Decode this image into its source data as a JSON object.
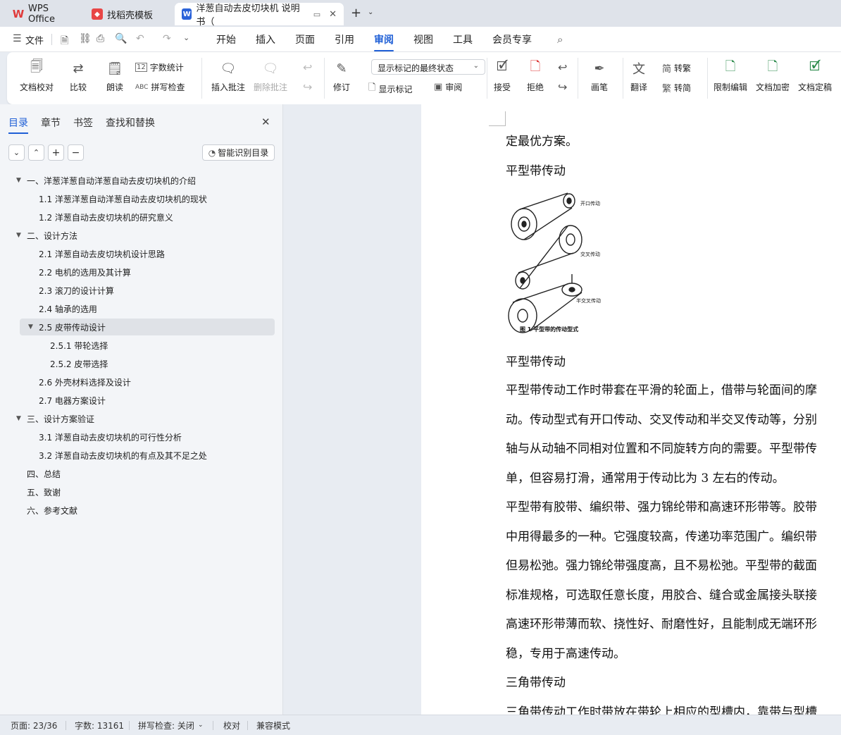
{
  "tabs": [
    {
      "label": "WPS Office",
      "icon": "wps-logo-icon",
      "color": "#e03a3a"
    },
    {
      "label": "找稻壳模板",
      "icon": "docer-logo-icon",
      "color": "#e84646"
    },
    {
      "label": "洋葱自动去皮切块机 说明书（",
      "icon": "word-doc-icon",
      "color": "#2b63d9"
    }
  ],
  "menu": {
    "file": "文件",
    "items": [
      "开始",
      "插入",
      "页面",
      "引用",
      "审阅",
      "视图",
      "工具",
      "会员专享"
    ],
    "active": "审阅"
  },
  "ribbon": {
    "proofread": "文档校对",
    "compare": "比较",
    "read_aloud": "朗读",
    "word_count": "字数统计",
    "spell_check": "拼写检查",
    "insert_comment": "插入批注",
    "delete_comment": "删除批注",
    "track": "修订",
    "show_markup_state": "显示标记的最终状态",
    "show_markup": "显示标记",
    "review": "审阅",
    "accept": "接受",
    "reject": "拒绝",
    "pen": "画笔",
    "translate": "翻译",
    "to_traditional": "转繁",
    "to_simplified": "转简",
    "restrict_edit": "限制编辑",
    "encrypt": "文档加密",
    "finalize": "文档定稿"
  },
  "sidebar": {
    "tabs": [
      "目录",
      "章节",
      "书签",
      "查找和替换"
    ],
    "smart_button": "智能识别目录",
    "toc": [
      {
        "label": "一、洋葱洋葱自动洋葱自动去皮切块机的介绍",
        "level": 1,
        "arrow": true
      },
      {
        "label": "1.1 洋葱洋葱自动洋葱自动去皮切块机的现状",
        "level": 2
      },
      {
        "label": "1.2 洋葱自动去皮切块机的研究意义",
        "level": 2
      },
      {
        "label": "二、设计方法",
        "level": 1,
        "arrow": true
      },
      {
        "label": "2.1 洋葱自动去皮切块机设计思路",
        "level": 2
      },
      {
        "label": "2.2 电机的选用及其计算",
        "level": 2
      },
      {
        "label": "2.3 滚刀的设计计算",
        "level": 2
      },
      {
        "label": "2.4 轴承的选用",
        "level": 2
      },
      {
        "label": "2.5 皮带传动设计",
        "level": 2,
        "arrow": true,
        "selected": true
      },
      {
        "label": "2.5.1 带轮选择",
        "level": 3
      },
      {
        "label": "2.5.2 皮带选择",
        "level": 3
      },
      {
        "label": "2.6 外壳材料选择及设计",
        "level": 2
      },
      {
        "label": "2.7 电器方案设计",
        "level": 2
      },
      {
        "label": "三、设计方案验证",
        "level": 1,
        "arrow": true
      },
      {
        "label": "3.1 洋葱自动去皮切块机的可行性分析",
        "level": 2
      },
      {
        "label": "3.2 洋葱自动去皮切块机的有点及其不足之处",
        "level": 2
      },
      {
        "label": "四、总结",
        "level": 1
      },
      {
        "label": "五、致谢",
        "level": 1
      },
      {
        "label": "六、参考文献",
        "level": 1
      }
    ]
  },
  "document": {
    "lines": [
      "定最优方案。",
      "平型带传动",
      " 平型带传动",
      "平型带传动工作时带套在平滑的轮面上，借带与轮面间的摩",
      "动。传动型式有开口传动、交叉传动和半交叉传动等，分别",
      "轴与从动轴不同相对位置和不同旋转方向的需要。平型带传",
      "单，但容易打滑，通常用于传动比为 3 左右的传动。",
      "平型带有胶带、编织带、强力锦纶带和高速环形带等。胶带",
      "中用得最多的一种。它强度较高，传递功率范围广。编织带",
      "但易松弛。强力锦纶带强度高，且不易松弛。平型带的截面",
      "标准规格，可选取任意长度，用胶合、缝合或金属接头联接",
      "高速环形带薄而软、挠性好、耐磨性好，且能制成无端环形",
      "稳，专用于高速传动。",
      "三角带传动",
      "三角带传动工作时带放在带轮上相应的型槽内，靠带与型槽"
    ],
    "figure": {
      "label_open": "开口传动",
      "label_cross": "交叉传动",
      "label_half": "半交叉传动",
      "caption": "图 1  平型带的传动型式"
    }
  },
  "status": {
    "page": "页面: 23/36",
    "words": "字数: 13161",
    "spell": "拼写检查: 关闭",
    "proof": "校对",
    "compat": "兼容模式"
  }
}
